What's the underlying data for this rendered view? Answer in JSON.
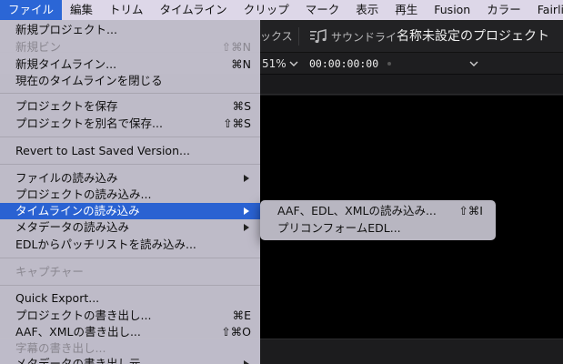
{
  "menubar": {
    "items": [
      {
        "label": "ファイル",
        "active": true
      },
      {
        "label": "編集"
      },
      {
        "label": "トリム"
      },
      {
        "label": "タイムライン"
      },
      {
        "label": "クリップ"
      },
      {
        "label": "マーク"
      },
      {
        "label": "表示"
      },
      {
        "label": "再生"
      },
      {
        "label": "Fusion"
      },
      {
        "label": "カラー"
      },
      {
        "label": "Fairlig"
      }
    ]
  },
  "toolbar": {
    "fragment": "ックス",
    "sound_label": "サウンドライ",
    "project_name": "名称未設定のプロジェクト"
  },
  "viewer": {
    "zoom": "51%",
    "timecode": "00:00:00:00"
  },
  "file_menu": {
    "items": [
      {
        "label": "新規プロジェクト...",
        "shortcut": ""
      },
      {
        "label": "新規ビン",
        "shortcut": "⇧⌘N",
        "disabled": true
      },
      {
        "label": "新規タイムライン...",
        "shortcut": "⌘N"
      },
      {
        "label": "現在のタイムラインを閉じる",
        "shortcut": ""
      },
      {
        "label": "プロジェクトを保存",
        "shortcut": "⌘S"
      },
      {
        "label": "プロジェクトを別名で保存...",
        "shortcut": "⇧⌘S"
      },
      {
        "label": "Revert to Last Saved Version...",
        "shortcut": ""
      },
      {
        "label": "ファイルの読み込み",
        "submenu": true
      },
      {
        "label": "プロジェクトの読み込み...",
        "shortcut": ""
      },
      {
        "label": "タイムラインの読み込み",
        "submenu": true,
        "highlighted": true
      },
      {
        "label": "メタデータの読み込み",
        "submenu": true
      },
      {
        "label": "EDLからパッチリストを読み込み...",
        "shortcut": ""
      },
      {
        "label": "キャプチャー",
        "disabled": true
      },
      {
        "label": "Quick Export...",
        "shortcut": ""
      },
      {
        "label": "プロジェクトの書き出し...",
        "shortcut": "⌘E"
      },
      {
        "label": "AAF、XMLの書き出し...",
        "shortcut": "⇧⌘O"
      },
      {
        "label": "字幕の書き出し...",
        "disabled": true
      },
      {
        "label": "メタデータの書き出し元",
        "submenu": true
      }
    ]
  },
  "submenu": {
    "items": [
      {
        "label": "AAF、EDL、XMLの読み込み...",
        "shortcut": "⇧⌘I"
      },
      {
        "label": "プリコンフォームEDL...",
        "shortcut": ""
      }
    ]
  }
}
